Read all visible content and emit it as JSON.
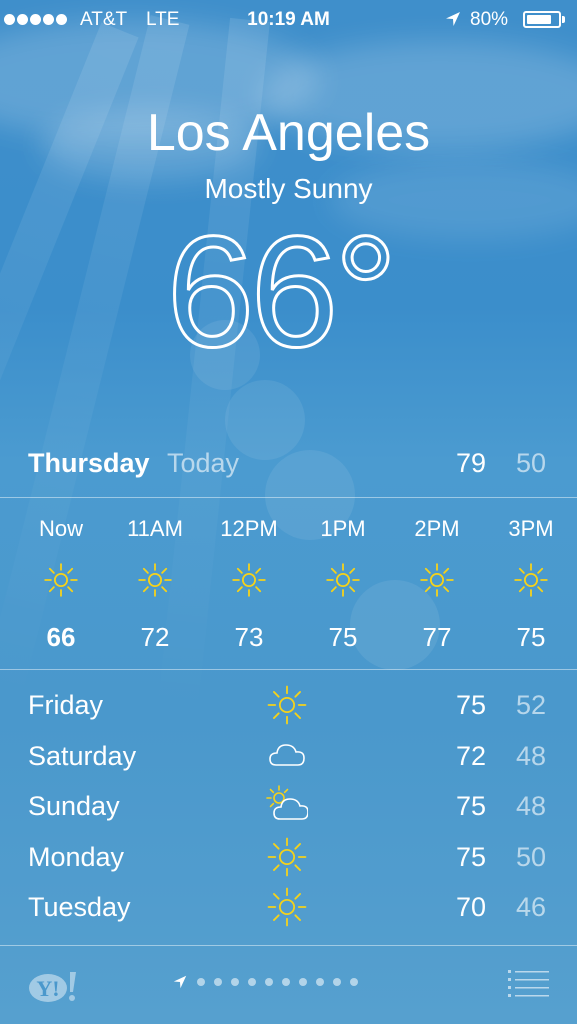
{
  "status_bar": {
    "signal_dots": 5,
    "carrier": "AT&T",
    "network": "LTE",
    "time": "10:19 AM",
    "battery_percent": "80%",
    "battery_level": 0.8,
    "location_icon": "location-arrow-icon"
  },
  "header": {
    "city": "Los Angeles",
    "condition": "Mostly Sunny",
    "temperature": "66°"
  },
  "today": {
    "day": "Thursday",
    "label": "Today",
    "high": "79",
    "low": "50"
  },
  "hourly": [
    {
      "time": "Now",
      "icon": "sun-icon",
      "temp": "66"
    },
    {
      "time": "11AM",
      "icon": "sun-icon",
      "temp": "72"
    },
    {
      "time": "12PM",
      "icon": "sun-icon",
      "temp": "73"
    },
    {
      "time": "1PM",
      "icon": "sun-icon",
      "temp": "75"
    },
    {
      "time": "2PM",
      "icon": "sun-icon",
      "temp": "77"
    },
    {
      "time": "3PM",
      "icon": "sun-icon",
      "temp": "75"
    }
  ],
  "forecast": [
    {
      "day": "Friday",
      "icon": "sun-icon",
      "high": "75",
      "low": "52"
    },
    {
      "day": "Saturday",
      "icon": "cloud-icon",
      "high": "72",
      "low": "48"
    },
    {
      "day": "Sunday",
      "icon": "partly-cloudy-icon",
      "high": "75",
      "low": "48"
    },
    {
      "day": "Monday",
      "icon": "sun-icon",
      "high": "75",
      "low": "50"
    },
    {
      "day": "Tuesday",
      "icon": "sun-icon",
      "high": "70",
      "low": "46"
    }
  ],
  "bottom_bar": {
    "logo": "Y!",
    "page_dots": 10,
    "icons": [
      "yahoo-logo-icon",
      "location-arrow-icon",
      "list-icon"
    ]
  },
  "colors": {
    "sky_top": "#3f8fcb",
    "sky_bottom": "#56a0cf",
    "sun_yellow": "#f5d21a",
    "text_dim": "rgba(255,255,255,0.6)"
  }
}
